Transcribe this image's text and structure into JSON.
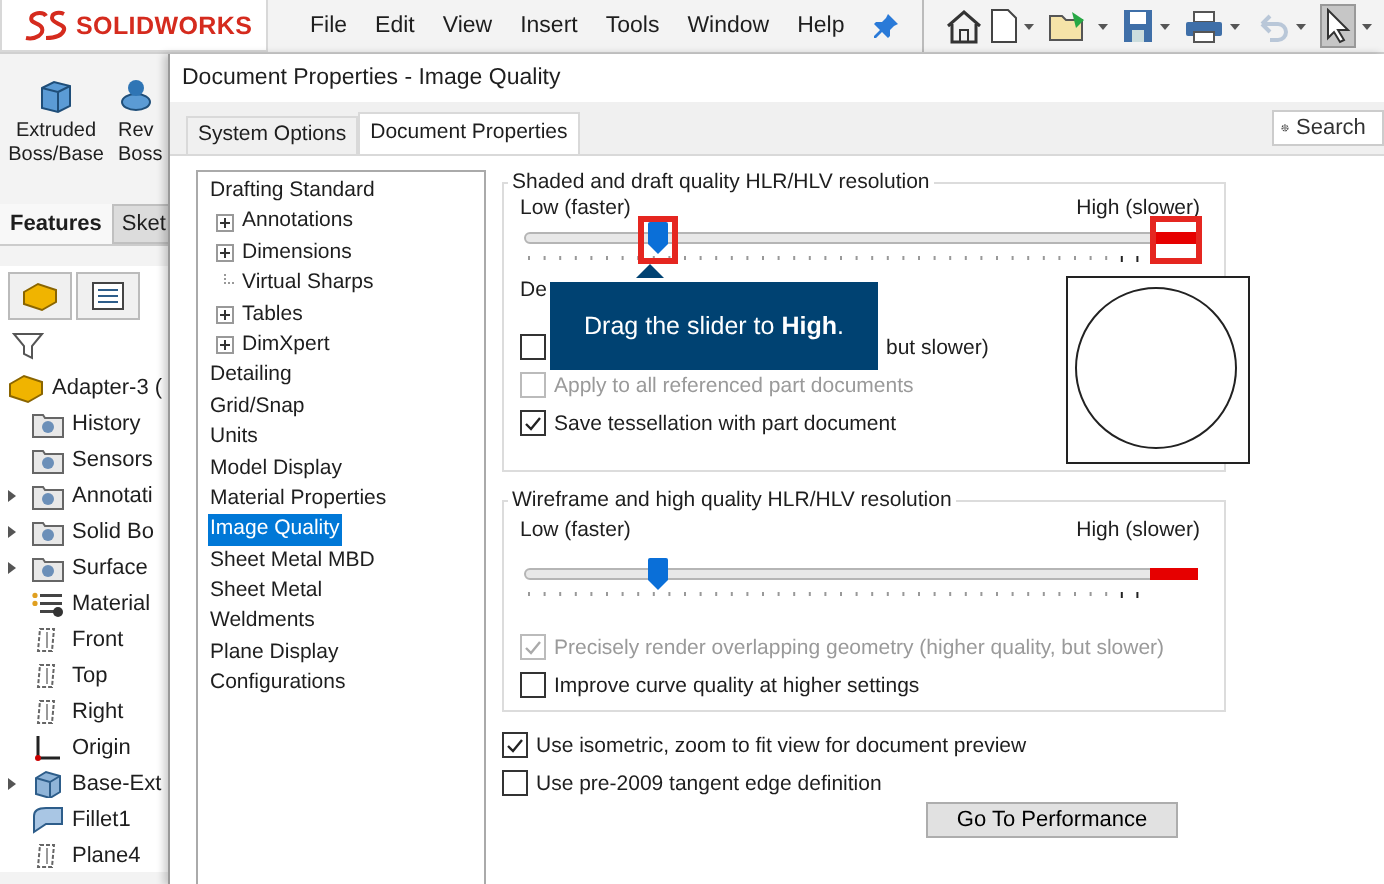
{
  "app": {
    "logo": "SOLIDWORKS",
    "menu": [
      "File",
      "Edit",
      "View",
      "Insert",
      "Tools",
      "Window",
      "Help"
    ]
  },
  "command_manager": {
    "tools": [
      {
        "lines": [
          "Extruded",
          "Boss/Base"
        ]
      },
      {
        "lines": [
          "Rev",
          "Boss"
        ]
      }
    ],
    "tabs": [
      {
        "label": "Features",
        "selected": true
      },
      {
        "label": "Sket",
        "selected": false
      }
    ]
  },
  "feature_tree": {
    "root": "Adapter-3 (",
    "items": [
      {
        "label": "History",
        "kind": "folder",
        "expandable": false
      },
      {
        "label": "Sensors",
        "kind": "folder",
        "expandable": false
      },
      {
        "label": "Annotati",
        "kind": "folder",
        "expandable": true
      },
      {
        "label": "Solid Bo",
        "kind": "folder",
        "expandable": true
      },
      {
        "label": "Surface",
        "kind": "folder",
        "expandable": true
      },
      {
        "label": "Material",
        "kind": "material",
        "expandable": false
      },
      {
        "label": "Front",
        "kind": "plane",
        "expandable": false
      },
      {
        "label": "Top",
        "kind": "plane",
        "expandable": false
      },
      {
        "label": "Right",
        "kind": "plane",
        "expandable": false
      },
      {
        "label": "Origin",
        "kind": "origin",
        "expandable": false
      },
      {
        "label": "Base-Ext",
        "kind": "extrude",
        "expandable": true
      },
      {
        "label": "Fillet1",
        "kind": "fillet",
        "expandable": false
      },
      {
        "label": "Plane4",
        "kind": "plane",
        "expandable": false
      }
    ]
  },
  "dialog": {
    "title": "Document Properties - Image Quality",
    "tabs": [
      {
        "label": "System Options",
        "selected": false
      },
      {
        "label": "Document Properties",
        "selected": true
      }
    ],
    "search": {
      "placeholder": "Search"
    },
    "categories": [
      {
        "label": "Drafting Standard",
        "selected": false,
        "children": [
          {
            "label": "Annotations",
            "expandable": true
          },
          {
            "label": "Dimensions",
            "expandable": true
          },
          {
            "label": "Virtual Sharps",
            "expandable": false
          },
          {
            "label": "Tables",
            "expandable": true
          },
          {
            "label": "DimXpert",
            "expandable": true
          }
        ]
      },
      {
        "label": "Detailing",
        "selected": false
      },
      {
        "label": "Grid/Snap",
        "selected": false
      },
      {
        "label": "Units",
        "selected": false
      },
      {
        "label": "Model Display",
        "selected": false
      },
      {
        "label": "Material Properties",
        "selected": false
      },
      {
        "label": "Image Quality",
        "selected": true
      },
      {
        "label": "Sheet Metal MBD",
        "selected": false
      },
      {
        "label": "Sheet Metal",
        "selected": false
      },
      {
        "label": "Weldments",
        "selected": false
      },
      {
        "label": "Plane Display",
        "selected": false
      },
      {
        "label": "Configurations",
        "selected": false
      }
    ],
    "shaded_group": {
      "title": "Shaded and draft quality HLR/HLV resolution",
      "low_label": "Low (faster)",
      "high_label": "High (slower)",
      "slider": {
        "level": 0.2
      },
      "deviation_label": "De",
      "options": [
        {
          "label": "but slower)",
          "checked": false,
          "disabled": false
        },
        {
          "label": "Apply to all referenced part documents",
          "checked": false,
          "disabled": true
        },
        {
          "label": "Save tessellation with part document",
          "checked": true,
          "disabled": false
        }
      ]
    },
    "wireframe_group": {
      "title": "Wireframe and high quality HLR/HLV resolution",
      "low_label": "Low (faster)",
      "high_label": "High (slower)",
      "slider": {
        "level": 0.2
      },
      "options": [
        {
          "label": "Precisely render overlapping geometry (higher quality, but slower)",
          "checked": true,
          "disabled": true
        },
        {
          "label": "Improve curve quality at higher settings",
          "checked": false,
          "disabled": false
        }
      ]
    },
    "options": [
      {
        "label": "Use isometric, zoom to fit view for document preview",
        "checked": true,
        "disabled": false
      },
      {
        "label": "Use pre-2009 tangent edge definition",
        "checked": false,
        "disabled": false
      }
    ],
    "performance_button": "Go To Performance",
    "callout": {
      "text": "Drag the slider to **High**."
    }
  }
}
